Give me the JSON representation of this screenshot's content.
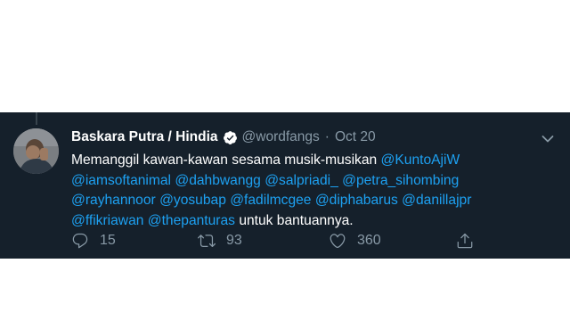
{
  "tweet": {
    "author_name": "Baskara Putra / Hindia",
    "handle": "@wordfangs",
    "separator": "·",
    "date": "Oct 20",
    "text": {
      "line1_intro": "Memanggil kawan-kawan sesama musik-musikan",
      "line4_outro": "untuk bantuannya.",
      "mentions": [
        "@KuntoAjiW",
        "@iamsoftanimal",
        "@dahbwangg",
        "@salpriadi_",
        "@petra_sihombing",
        "@rayhannoor",
        "@yosubap",
        "@fadilmcgee",
        "@diphabarus",
        "@danillajpr",
        "@ffikriawan",
        "@thepanturas"
      ]
    },
    "actions": {
      "reply_count": "15",
      "retweet_count": "93",
      "like_count": "360"
    }
  },
  "icons": {
    "verified": "verified-badge-icon",
    "more": "chevron-down-icon",
    "reply": "reply-icon",
    "retweet": "retweet-icon",
    "like": "heart-icon",
    "share": "share-icon"
  },
  "colors": {
    "background": "#15202b",
    "text": "#ffffff",
    "secondary": "#8899a6",
    "link": "#1da1f2"
  }
}
